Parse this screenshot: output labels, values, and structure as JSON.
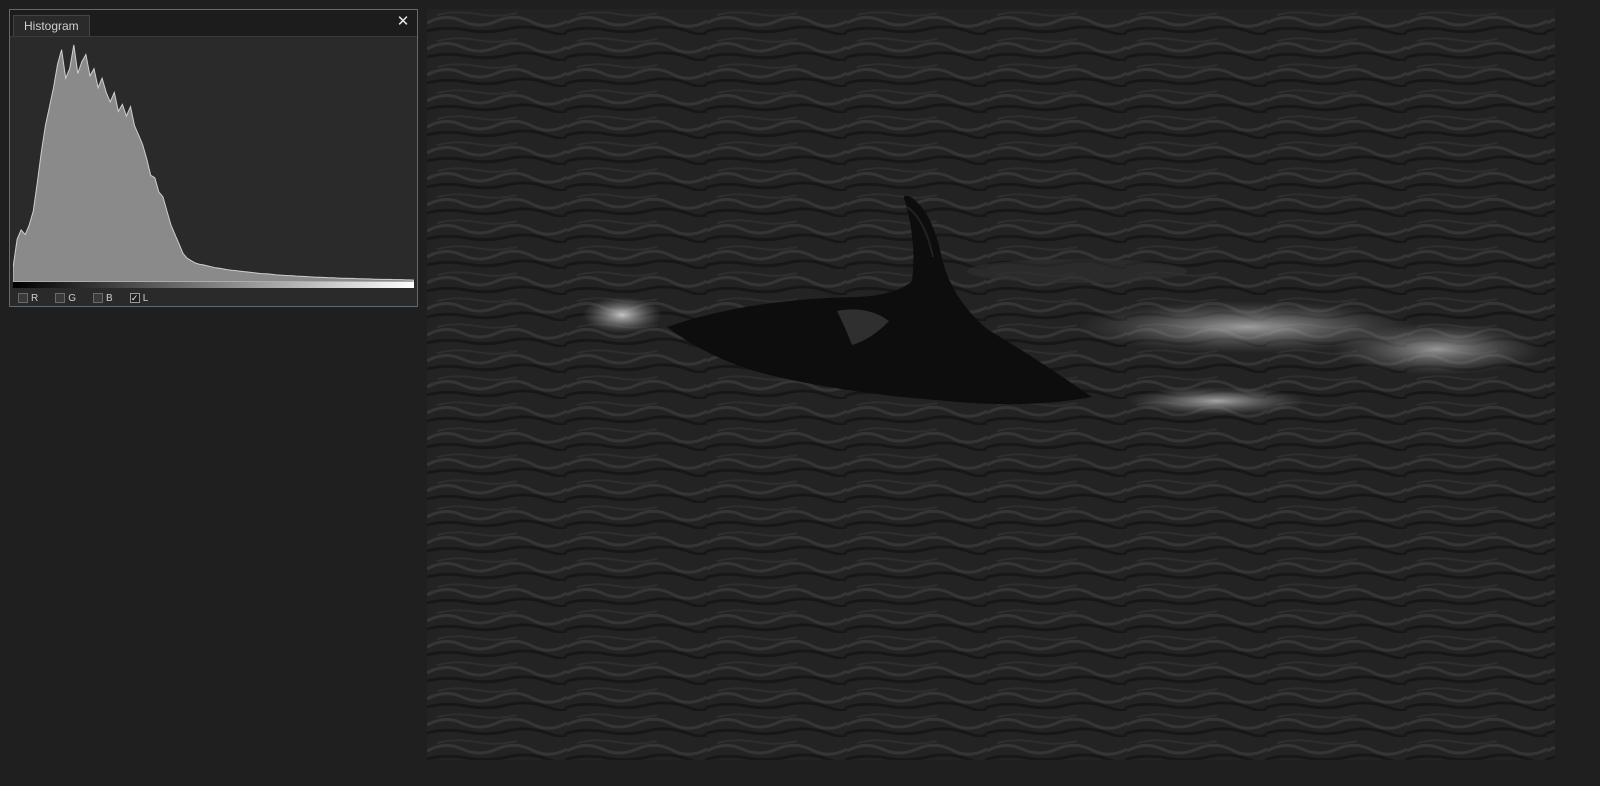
{
  "panel": {
    "tab_label": "Histogram",
    "close_glyph": "✕",
    "close_icon": "close-icon"
  },
  "channels": [
    {
      "label": "R",
      "checked": false
    },
    {
      "label": "G",
      "checked": false
    },
    {
      "label": "B",
      "checked": false
    },
    {
      "label": "L",
      "checked": true
    }
  ],
  "check_glyph": "✓",
  "histogram": {
    "channel": "luminance",
    "levels": [
      0.06,
      0.18,
      0.22,
      0.2,
      0.24,
      0.3,
      0.42,
      0.55,
      0.66,
      0.74,
      0.82,
      0.92,
      0.98,
      0.86,
      0.9,
      1.0,
      0.88,
      0.93,
      0.96,
      0.87,
      0.9,
      0.82,
      0.86,
      0.8,
      0.76,
      0.8,
      0.72,
      0.75,
      0.7,
      0.74,
      0.66,
      0.62,
      0.58,
      0.52,
      0.45,
      0.44,
      0.38,
      0.36,
      0.3,
      0.24,
      0.2,
      0.16,
      0.12,
      0.1,
      0.09,
      0.08,
      0.075,
      0.072,
      0.068,
      0.064,
      0.06,
      0.058,
      0.055,
      0.052,
      0.05,
      0.048,
      0.046,
      0.044,
      0.042,
      0.04,
      0.038,
      0.036,
      0.035,
      0.034,
      0.032,
      0.03,
      0.029,
      0.028,
      0.027,
      0.026,
      0.025,
      0.024,
      0.023,
      0.022,
      0.021,
      0.02,
      0.02,
      0.019,
      0.018,
      0.018,
      0.017,
      0.016,
      0.016,
      0.015,
      0.015,
      0.014,
      0.014,
      0.013,
      0.013,
      0.012,
      0.012,
      0.011,
      0.011,
      0.011,
      0.01,
      0.01,
      0.01,
      0.009,
      0.009,
      0.008
    ],
    "fill_color": "#8a8a8a",
    "stroke_color": "#cfcfcf"
  },
  "photo": {
    "description_icon": "orca-image",
    "water_color": "#2a2a2a",
    "orca_color": "#0d0d0d",
    "spray_color": "#bdbdbd"
  }
}
